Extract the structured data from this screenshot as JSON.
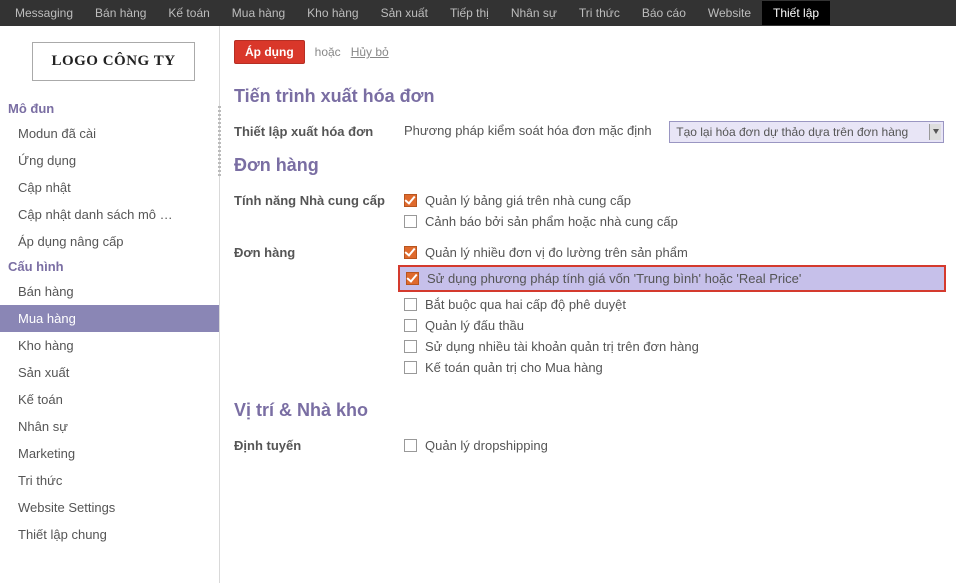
{
  "topnav": {
    "items": [
      "Messaging",
      "Bán hàng",
      "Kế toán",
      "Mua hàng",
      "Kho hàng",
      "Sản xuất",
      "Tiếp thị",
      "Nhân sự",
      "Tri thức",
      "Báo cáo",
      "Website",
      "Thiết lập"
    ],
    "active": "Thiết lập"
  },
  "logo": "LOGO CÔNG TY",
  "sidebar": {
    "sections": [
      {
        "title": "Mô đun",
        "items": [
          "Modun đã cài",
          "Ứng dụng",
          "Cập nhật",
          "Cập nhật danh sách mô …",
          "Áp dụng nâng cấp"
        ]
      },
      {
        "title": "Cấu hình",
        "items": [
          "Bán hàng",
          "Mua hàng",
          "Kho hàng",
          "Sản xuất",
          "Kế toán",
          "Nhân sự",
          "Marketing",
          "Tri thức",
          "Website Settings",
          "Thiết lập chung"
        ],
        "active": "Mua hàng"
      }
    ]
  },
  "actions": {
    "apply": "Áp dụng",
    "or": "hoặc",
    "cancel": "Hủy bỏ"
  },
  "sections": {
    "invoice": {
      "title": "Tiến trình xuất hóa đơn",
      "field_label": "Thiết lập xuất hóa đơn",
      "method_text": "Phương pháp kiểm soát hóa đơn mặc định",
      "select_value": "Tạo lại hóa đơn dự thảo dựa trên đơn hàng"
    },
    "order": {
      "title": "Đơn hàng",
      "supplier_label": "Tính năng Nhà cung cấp",
      "supplier_opts": [
        {
          "label": "Quản lý bảng giá trên nhà cung cấp",
          "checked": true
        },
        {
          "label": "Cảnh báo bởi sản phẩm hoặc nhà cung cấp",
          "checked": false
        }
      ],
      "order_label": "Đơn hàng",
      "order_opts": [
        {
          "label": "Quản lý nhiều đơn vị đo lường trên sản phẩm",
          "checked": true,
          "highlight": false
        },
        {
          "label": "Sử dụng phương pháp tính giá vốn 'Trung bình' hoặc 'Real Price'",
          "checked": true,
          "highlight": true
        },
        {
          "label": "Bắt buộc qua hai cấp độ phê duyệt",
          "checked": false,
          "highlight": false
        },
        {
          "label": "Quản lý đấu thầu",
          "checked": false,
          "highlight": false
        },
        {
          "label": "Sử dụng nhiều tài khoản quản trị trên đơn hàng",
          "checked": false,
          "highlight": false
        },
        {
          "label": "Kế toán quản trị cho Mua hàng",
          "checked": false,
          "highlight": false
        }
      ]
    },
    "warehouse": {
      "title": "Vị trí & Nhà kho",
      "routing_label": "Định tuyến",
      "routing_opts": [
        {
          "label": "Quản lý dropshipping",
          "checked": false
        }
      ]
    }
  }
}
